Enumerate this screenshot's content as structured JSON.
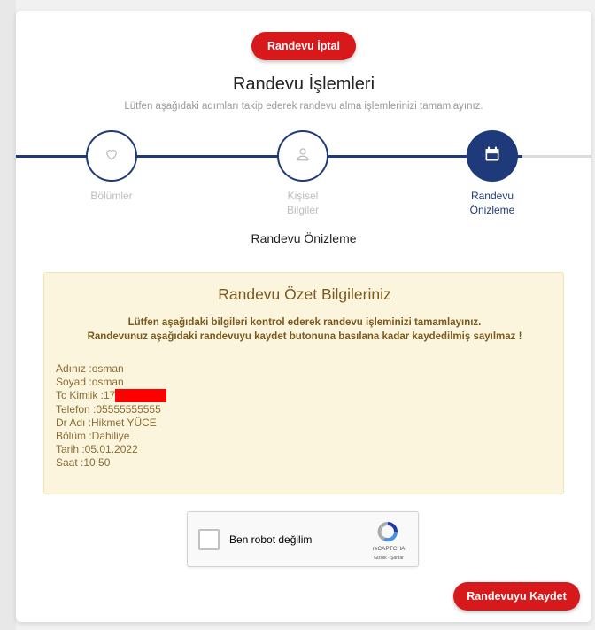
{
  "header": {
    "cancel_label": "Randevu İptal",
    "title": "Randevu İşlemleri",
    "subtitle": "Lütfen aşağıdaki adımları takip ederek randevu alma işlemlerinizi tamamlayınız."
  },
  "steps": [
    {
      "line1": "Bölümler",
      "line2": "",
      "icon": "heart-icon",
      "active": false
    },
    {
      "line1": "Kişisel",
      "line2": "Bilgiler",
      "icon": "user-icon",
      "active": false
    },
    {
      "line1": "Randevu",
      "line2": "Önizleme",
      "icon": "calendar-icon",
      "active": true
    }
  ],
  "preview_title": "Randevu Önizleme",
  "summary": {
    "title": "Randevu Özet Bilgileriniz",
    "notice_1": "Lütfen aşağıdaki bilgileri kontrol ederek randevu işleminizi tamamlayınız.",
    "notice_2": "Randevunuz aşağıdaki randevuyu kaydet butonuna basılana kadar kaydedilmiş sayılmaz !",
    "fields": {
      "name": "Adınız :osman",
      "surname": "Soyad :osman",
      "tc": "Tc Kimlik :17",
      "phone": "Telefon :05555555555",
      "doctor": "Dr Adı :Hikmet YÜCE",
      "department": "Bölüm :Dahiliye",
      "date": "Tarih :05.01.2022",
      "time": "Saat :10:50"
    }
  },
  "captcha": {
    "label": "Ben robot değilim",
    "brand": "reCAPTCHA",
    "links": "Gizlilik - Şartlar"
  },
  "save_label": "Randevuyu Kaydet",
  "colors": {
    "brand_red": "#d7191c",
    "navy": "#1f3a7a",
    "summary_bg": "#fcf5dd",
    "summary_text": "#7a5a1e"
  }
}
